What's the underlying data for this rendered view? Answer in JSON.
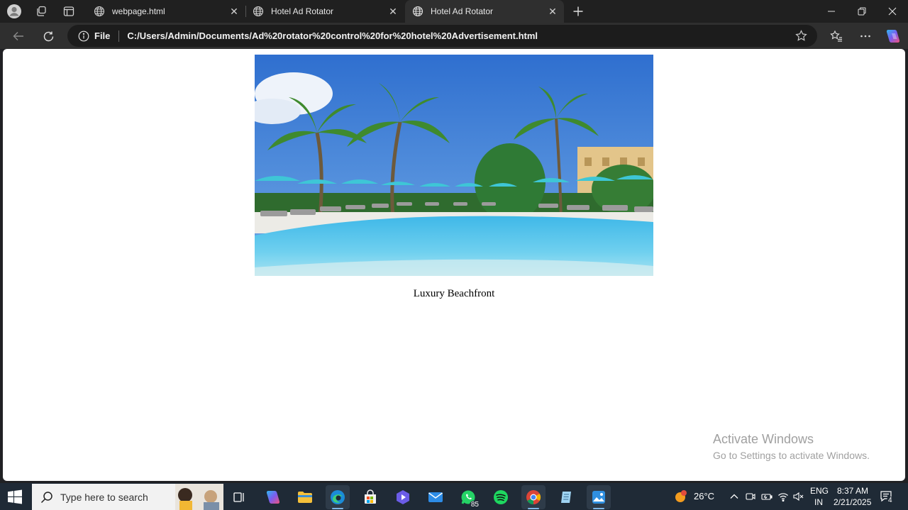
{
  "browser": {
    "tabs": [
      {
        "label": "webpage.html",
        "active": false
      },
      {
        "label": "Hotel Ad Rotator",
        "active": false
      },
      {
        "label": "Hotel Ad Rotator",
        "active": true
      }
    ],
    "address": {
      "scheme_label": "File",
      "url": "C:/Users/Admin/Documents/Ad%20rotator%20control%20for%20hotel%20Advertisement.html"
    }
  },
  "page": {
    "ad": {
      "image_alt": "Hotel pool with palm trees",
      "caption": "Luxury Beachfront"
    }
  },
  "watermark": {
    "title": "Activate Windows",
    "subtitle": "Go to Settings to activate Windows."
  },
  "taskbar": {
    "search_placeholder": "Type here to search",
    "whatsapp_badge": "85",
    "weather": "26°C",
    "language_line1": "ENG",
    "language_line2": "IN",
    "time": "8:37 AM",
    "date": "2/21/2025",
    "notification_count": "4"
  },
  "colors": {
    "accent": "#7fb6e6",
    "taskbar_bg": "#1f2a36",
    "tab_bg": "#202020",
    "page_bg": "#ffffff"
  }
}
